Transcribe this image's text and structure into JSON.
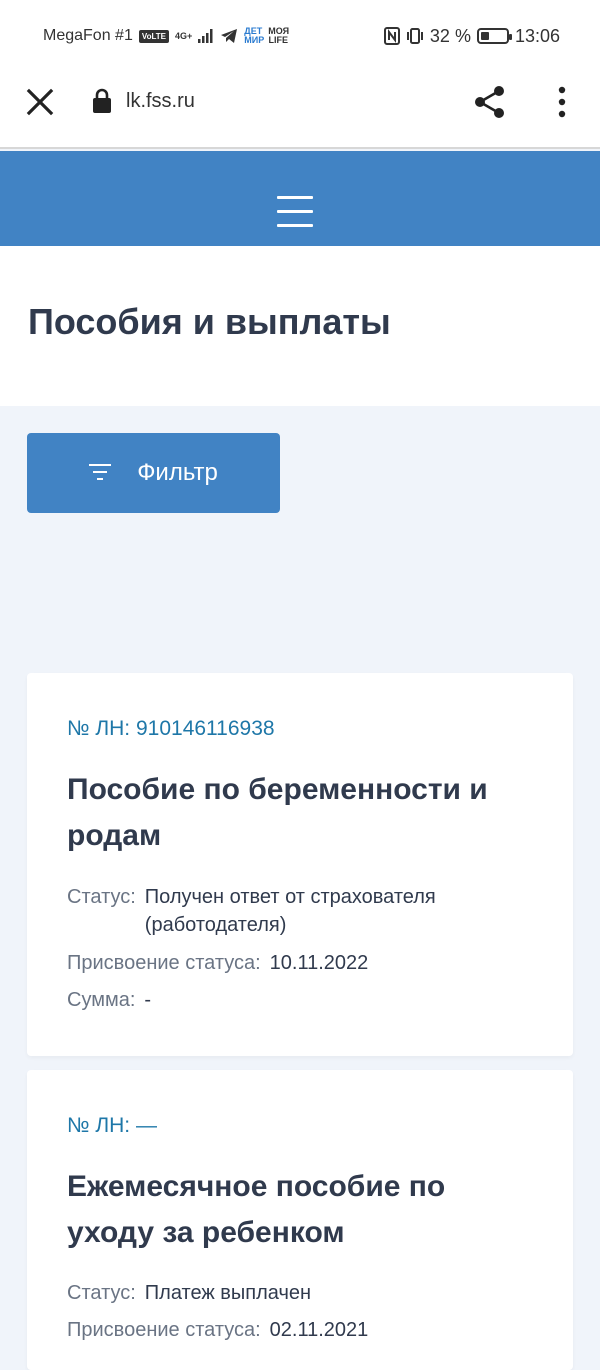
{
  "status_bar": {
    "carrier": "MegaFon #1",
    "volte": "VoLTE",
    "network": "4G+",
    "app_icon_1": "ДЕТ МИР",
    "app_icon_2": "МОЯ LIFE",
    "battery": "32 %",
    "battery_level": 0.32,
    "time": "13:06"
  },
  "browser": {
    "url": "lk.fss.ru",
    "icons": [
      "close-icon",
      "lock-icon",
      "share-icon",
      "more-vert-icon"
    ]
  },
  "header": {
    "menu_icon": "hamburger-icon",
    "color": "#4183c4"
  },
  "page": {
    "title": "Пособия и выплаты"
  },
  "filter": {
    "label": "Фильтр",
    "icon": "filter-icon"
  },
  "cards": [
    {
      "ln": "№ ЛН: 910146116938",
      "title": "Пособие по беременности и родам",
      "status_label": "Статус:",
      "status": "Получен ответ от страхователя (работодателя)",
      "assign_label": "Присвоение статуса:",
      "assign_date": "10.11.2022",
      "sum_label": "Сумма:",
      "sum": "-"
    },
    {
      "ln": "№ ЛН: —",
      "title": "Ежемесячное пособие по уходу за ребенком",
      "status_label": "Статус:",
      "status": "Платеж выплачен",
      "assign_label": "Присвоение статуса:",
      "assign_date": "02.11.2021"
    }
  ],
  "colors": {
    "accent": "#4183c4",
    "link": "#1e77a8",
    "text": "#303a4d",
    "muted": "#6a7484",
    "background": "#f0f4fa"
  }
}
